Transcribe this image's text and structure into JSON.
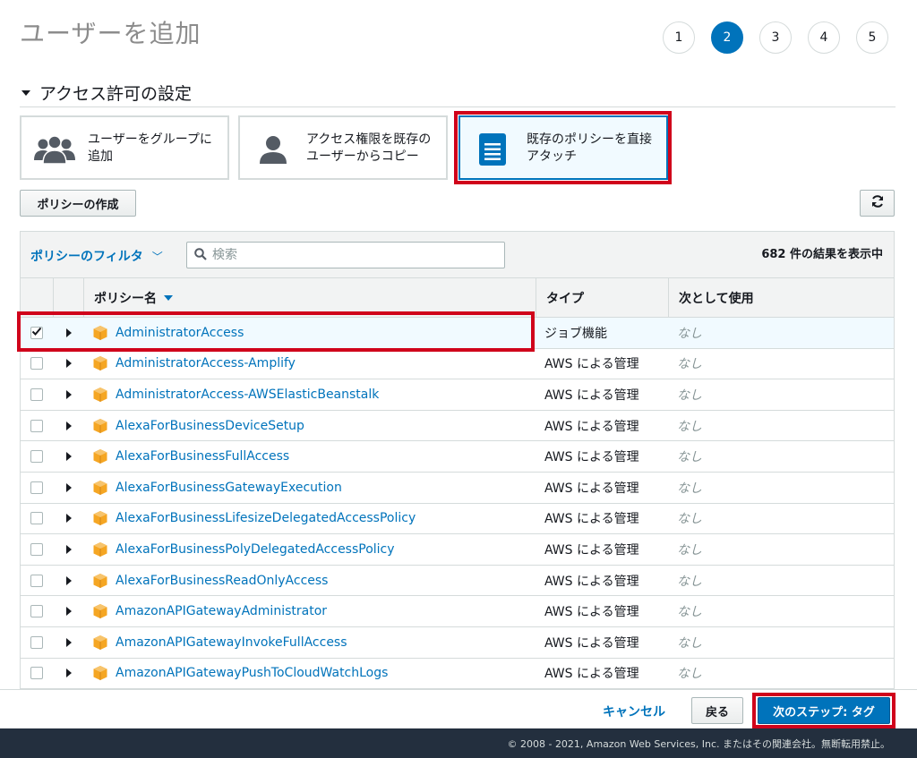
{
  "page": {
    "title": "ユーザーを追加"
  },
  "steps": [
    {
      "label": "1",
      "active": false
    },
    {
      "label": "2",
      "active": true
    },
    {
      "label": "3",
      "active": false
    },
    {
      "label": "4",
      "active": false
    },
    {
      "label": "5",
      "active": false
    }
  ],
  "section": {
    "title": "アクセス許可の設定"
  },
  "options": [
    {
      "label": "ユーザーをグループに追加",
      "icon": "users-group-icon",
      "selected": false
    },
    {
      "label": "アクセス権限を既存のユーザーからコピー",
      "icon": "user-icon",
      "selected": false
    },
    {
      "label": "既存のポリシーを直接アタッチ",
      "icon": "document-icon",
      "selected": true
    }
  ],
  "actions": {
    "create_policy": "ポリシーの作成",
    "refresh_icon": "refresh-icon"
  },
  "toolbar": {
    "filter_label": "ポリシーのフィルタ",
    "filter_chevron": "﹀",
    "search_placeholder": "検索",
    "result_count": "682 件の結果を表示中"
  },
  "table": {
    "headers": {
      "name": "ポリシー名",
      "type": "タイプ",
      "used_as": "次として使用"
    },
    "rows": [
      {
        "name": "AdministratorAccess",
        "type": "ジョブ機能",
        "used_as": "なし",
        "checked": true
      },
      {
        "name": "AdministratorAccess-Amplify",
        "type": "AWS による管理",
        "used_as": "なし",
        "checked": false
      },
      {
        "name": "AdministratorAccess-AWSElasticBeanstalk",
        "type": "AWS による管理",
        "used_as": "なし",
        "checked": false
      },
      {
        "name": "AlexaForBusinessDeviceSetup",
        "type": "AWS による管理",
        "used_as": "なし",
        "checked": false
      },
      {
        "name": "AlexaForBusinessFullAccess",
        "type": "AWS による管理",
        "used_as": "なし",
        "checked": false
      },
      {
        "name": "AlexaForBusinessGatewayExecution",
        "type": "AWS による管理",
        "used_as": "なし",
        "checked": false
      },
      {
        "name": "AlexaForBusinessLifesizeDelegatedAccessPolicy",
        "type": "AWS による管理",
        "used_as": "なし",
        "checked": false
      },
      {
        "name": "AlexaForBusinessPolyDelegatedAccessPolicy",
        "type": "AWS による管理",
        "used_as": "なし",
        "checked": false
      },
      {
        "name": "AlexaForBusinessReadOnlyAccess",
        "type": "AWS による管理",
        "used_as": "なし",
        "checked": false
      },
      {
        "name": "AmazonAPIGatewayAdministrator",
        "type": "AWS による管理",
        "used_as": "なし",
        "checked": false
      },
      {
        "name": "AmazonAPIGatewayInvokeFullAccess",
        "type": "AWS による管理",
        "used_as": "なし",
        "checked": false
      },
      {
        "name": "AmazonAPIGatewayPushToCloudWatchLogs",
        "type": "AWS による管理",
        "used_as": "なし",
        "checked": false
      }
    ]
  },
  "footer_actions": {
    "cancel": "キャンセル",
    "back": "戻る",
    "next": "次のステップ: タグ"
  },
  "footer": {
    "copyright": "© 2008 - 2021, Amazon Web Services, Inc. またはその関連会社。無断転用禁止。"
  },
  "colors": {
    "accent": "#0073bb",
    "highlight": "#d0021b",
    "policy_icon": "#f5a623",
    "footer_bg": "#232f3e"
  }
}
